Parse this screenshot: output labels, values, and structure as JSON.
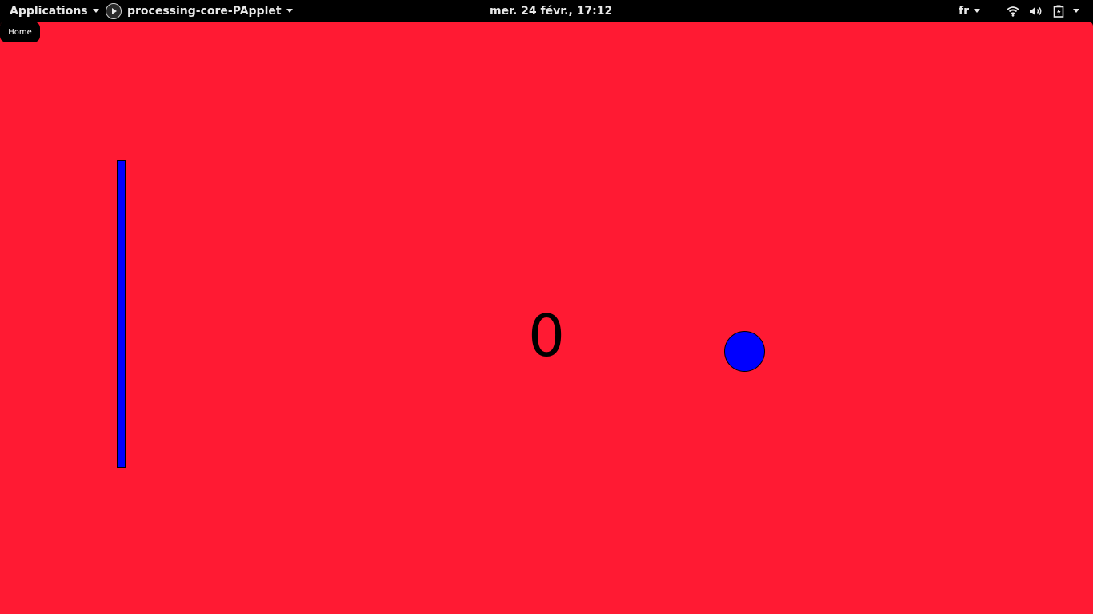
{
  "topbar": {
    "applications_label": "Applications",
    "active_app_label": "processing-core-PApplet",
    "clock": "mer. 24 févr., 17:12",
    "keyboard_layout": "fr",
    "icons": {
      "active_app": "processing-play-icon",
      "wifi": "wifi-icon",
      "volume": "volume-icon",
      "battery": "battery-icon"
    }
  },
  "sketch": {
    "home_button_label": "Home",
    "score": "0",
    "background_color": "#ff1a33",
    "paddle_color": "#0000ff",
    "ball_color": "#0000ff"
  }
}
